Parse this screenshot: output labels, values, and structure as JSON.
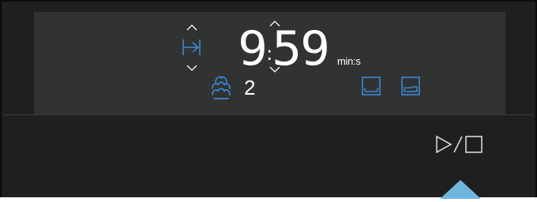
{
  "display": {
    "time": {
      "minutes": "9",
      "separator": ":",
      "seconds": "59",
      "unit": "min:s"
    },
    "steam_level": "2",
    "icons": {
      "timer": "timer-end-icon",
      "steam": "steam-icon",
      "tank_left": "water-tank-icon",
      "tank_right": "water-tank-icon",
      "up_chevron": "chevron-up-icon",
      "down_chevron": "chevron-down-icon"
    }
  },
  "controls": {
    "start_stop": {
      "icon": "play-stop-icon",
      "label": "▷/□"
    }
  },
  "colors": {
    "accent": "#3a8ad6",
    "display_bg": "#313232",
    "panel_bg": "#1f1f20",
    "arrow": "#6fb6df"
  }
}
